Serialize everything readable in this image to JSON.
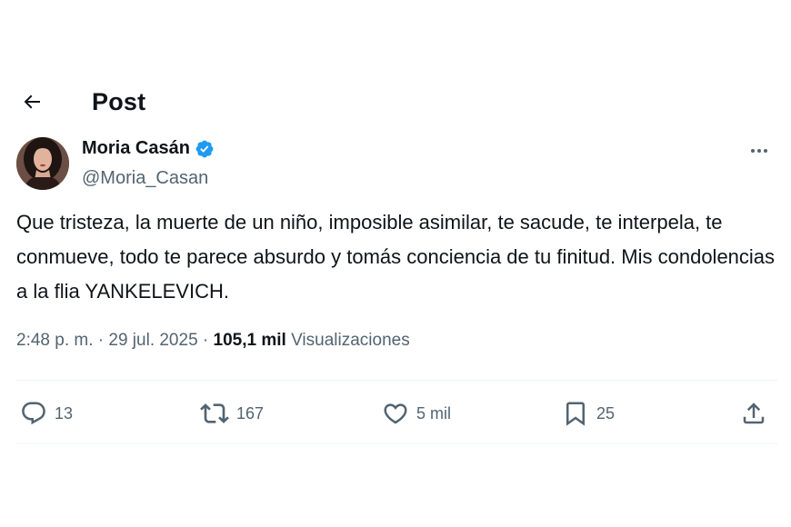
{
  "header": {
    "title": "Post",
    "back_icon": "arrow-left-icon"
  },
  "author": {
    "display_name": "Moria Casán",
    "handle": "@Moria_Casan",
    "verified": true,
    "verified_color": "#1d9bf0"
  },
  "post": {
    "text": "Que tristeza, la muerte de un niño, imposible asimilar, te sacude, te interpela, te conmueve, todo te parece absurdo y tomás conciencia de tu finitud. Mis condolencias a la flia YANKELEVICH.",
    "time": "2:48 p. m.",
    "separator": "·",
    "date": "29 jul. 2025",
    "views_count": "105,1 mil",
    "views_label": "Visualizaciones"
  },
  "actions": {
    "replies": "13",
    "reposts": "167",
    "likes": "5 mil",
    "bookmarks": "25"
  },
  "colors": {
    "text": "#0f1419",
    "secondary": "#536471",
    "divider": "#eff3f4",
    "accent": "#1d9bf0"
  }
}
